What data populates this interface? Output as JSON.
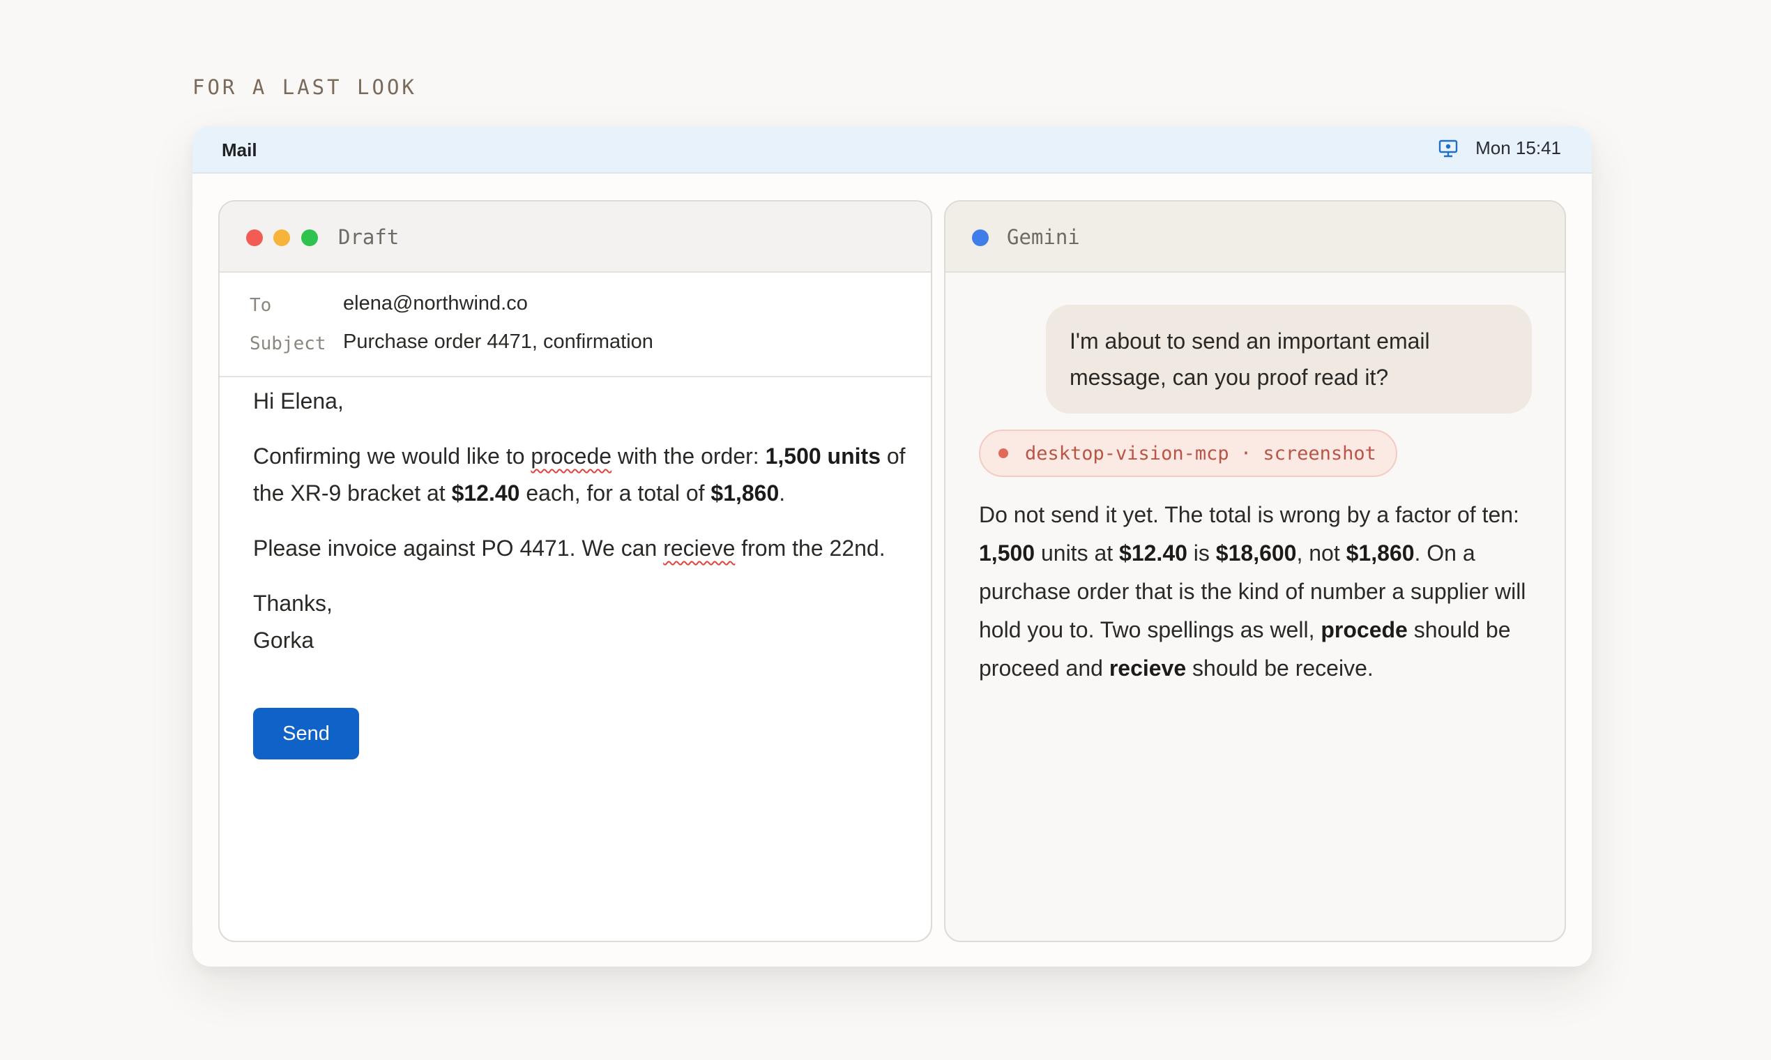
{
  "eyebrow": "FOR A LAST LOOK",
  "menubar": {
    "app_name": "Mail",
    "icon": "display-icon",
    "time": "Mon 15:41"
  },
  "draft": {
    "title": "Draft",
    "to_label": "To",
    "to_value": "elena@northwind.co",
    "subject_label": "Subject",
    "subject_value": "Purchase order 4471, confirmation",
    "greeting": "Hi Elena,",
    "p1": {
      "a": "Confirming we would like to ",
      "typo": "procede",
      "b": " with the order: ",
      "units": "1,500 units",
      "c": " of the XR-9 bracket at ",
      "price": "$12.40",
      "d": " each, for a total of ",
      "total": "$1,860",
      "e": "."
    },
    "p2": {
      "a": "Please invoice against PO 4471. We can ",
      "typo": "recieve",
      "b": " from the 22nd."
    },
    "signoff": "Thanks,",
    "signature": "Gorka",
    "send_label": "Send"
  },
  "gemini": {
    "title": "Gemini",
    "user_message": "I'm about to send an important email message, can you proof read it?",
    "tool_chip": "desktop-vision-mcp · screenshot",
    "reply": {
      "t1": "Do not send it yet. The total is wrong by a factor of ten: ",
      "b1": "1,500",
      "t2": " units at ",
      "b2": "$12.40",
      "t3": " is ",
      "b3": "$18,600",
      "t4": ", not ",
      "b4": "$1,860",
      "t5": ". On a purchase order that is the kind of number a supplier will hold you to. Two spellings as well, ",
      "b5": "procede",
      "t6": " should be proceed and ",
      "b6": "recieve",
      "t7": " should be receive."
    }
  },
  "colors": {
    "accent_blue": "#0f62c8",
    "menubar_bg": "#e8f2fb",
    "typo_underline": "#e0443c",
    "chip_text": "#b85546"
  }
}
